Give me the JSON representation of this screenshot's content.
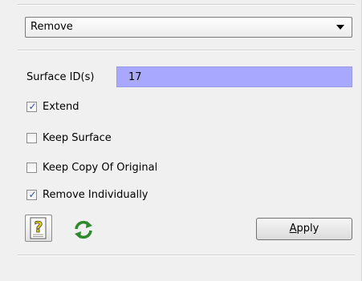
{
  "operation": {
    "selected": "Remove"
  },
  "surface": {
    "label": "Surface ID(s)",
    "value": "17"
  },
  "options": [
    {
      "label": "Extend",
      "checked": true
    },
    {
      "label": "Keep Surface",
      "checked": false
    },
    {
      "label": "Keep Copy Of Original",
      "checked": false
    },
    {
      "label": "Remove Individually",
      "checked": true
    }
  ],
  "footer": {
    "apply_mnemonic": "A",
    "apply_rest": "pply",
    "help_icon": "help-document-icon",
    "refresh_icon": "refresh-icon"
  },
  "colors": {
    "id_field_bg": "#a8a8ff",
    "check_color": "#2a4fa0"
  }
}
